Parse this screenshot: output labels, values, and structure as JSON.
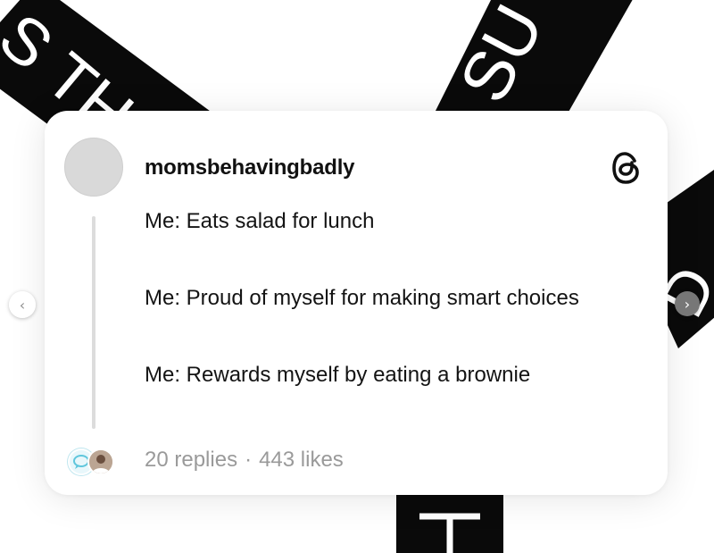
{
  "background": {
    "band_color": "#0a0a0a",
    "text_color": "#ffffff"
  },
  "post": {
    "username": "momsbehavingbadly",
    "paragraphs": [
      "Me: Eats salad for lunch",
      "Me: Proud of myself for making smart choices",
      "Me: Rewards myself by eating a brownie"
    ],
    "replies": "20 replies",
    "separator": "·",
    "likes": "443 likes"
  },
  "icons": {
    "brand": "threads-logo-icon",
    "prev": "chevron-left-icon",
    "next": "chevron-right-icon"
  },
  "nav": {
    "prev_glyph": "‹",
    "next_glyph": "›"
  }
}
